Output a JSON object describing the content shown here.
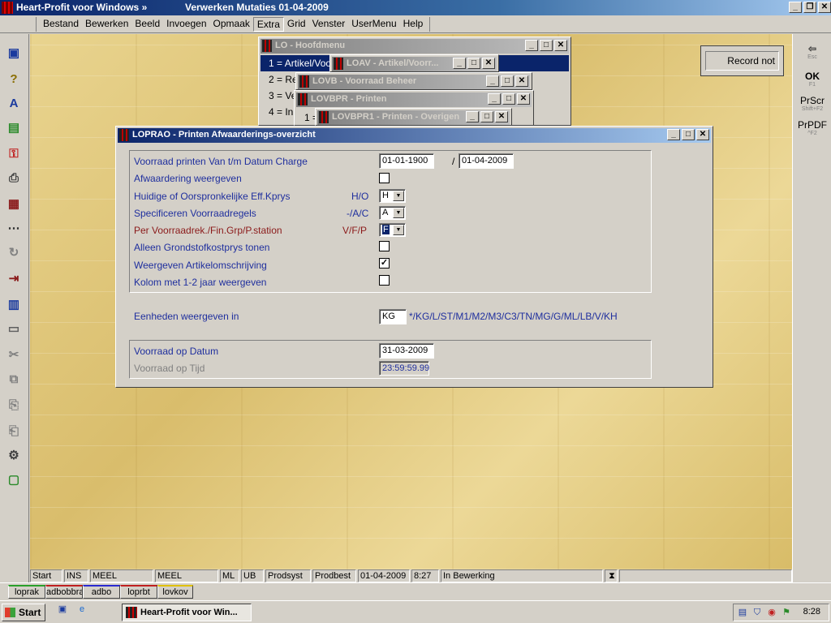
{
  "app": {
    "title": "Heart-Profit voor Windows  »",
    "subtitle": "Verwerken Mutaties 01-04-2009"
  },
  "menu": [
    "Bestand",
    "Bewerken",
    "Beeld",
    "Invoegen",
    "Opmaak",
    "Extra",
    "Grid",
    "Venster",
    "UserMenu",
    "Help"
  ],
  "right_toolbar": {
    "esc": {
      "label": "Esc"
    },
    "ok": {
      "label": "OK",
      "key": "F1"
    },
    "prscr": {
      "label": "PrScr",
      "key": "Shift+F2"
    },
    "prpdf": {
      "label": "PrPDF",
      "key": "^F2"
    }
  },
  "record_box": "Record not",
  "windows": {
    "hoofdmenu": {
      "title": "LO - Hoofdmenu",
      "items": [
        "1 = Artikel/Voo",
        "2 = Re",
        "3 = Ve",
        "4 = In"
      ]
    },
    "loav": {
      "title": "LOAV - Artikel/Voorr..."
    },
    "lovb": {
      "title": "LOVB - Voorraad Beheer"
    },
    "lovbpr": {
      "title": "LOVBPR - Printen",
      "item": "1 ="
    },
    "lovbpr1": {
      "title": "LOVBPR1 - Printen - Overigen"
    }
  },
  "dialog": {
    "title": "LOPRAO - Printen Afwaarderings-overzicht",
    "rows": {
      "charge": {
        "label": "Voorraad printen Van t/m Datum Charge",
        "from": "01-01-1900",
        "sep": "/",
        "to": "01-04-2009"
      },
      "afwaardering": {
        "label": "Afwaardering weergeven",
        "checked": ""
      },
      "kprys": {
        "label": "Huidige of Oorspronkelijke Eff.Kprys",
        "code": "H/O",
        "value": "H"
      },
      "specificeren": {
        "label": "Specificeren Voorraadregels",
        "code": "-/A/C",
        "value": "A"
      },
      "per": {
        "label": "Per Voorraadrek./Fin.Grp/P.station",
        "code": "V/F/P",
        "value": "F"
      },
      "grondstof": {
        "label": "Alleen Grondstofkostprys tonen",
        "checked": ""
      },
      "omschrijving": {
        "label": "Weergeven Artikelomschrijving",
        "checked": "✓"
      },
      "kolom": {
        "label": "Kolom met 1-2 jaar weergeven",
        "checked": ""
      }
    },
    "eenheden": {
      "label": "Eenheden weergeven in",
      "value": "KG",
      "options": "*/KG/L/ST/M1/M2/M3/C3/TN/MG/G/ML/LB/V/KH"
    },
    "voorraad_datum": {
      "label": "Voorraad op Datum",
      "value": "31-03-2009"
    },
    "voorraad_tijd": {
      "label": "Voorraad op Tijd",
      "value": "23:59:59.99"
    }
  },
  "status": [
    "Start",
    "INS",
    "MEEL",
    "MEEL",
    "ML",
    "UB",
    "Prodsyst",
    "Prodbest",
    "01-04-2009",
    "8:27",
    "In Bewerking"
  ],
  "tabs": [
    "loprak",
    "adbobbra",
    "adbo",
    "loprbt",
    "lovkov"
  ],
  "taskbar": {
    "start": "Start",
    "task": "Heart-Profit voor Win...",
    "clock": "8:28"
  }
}
